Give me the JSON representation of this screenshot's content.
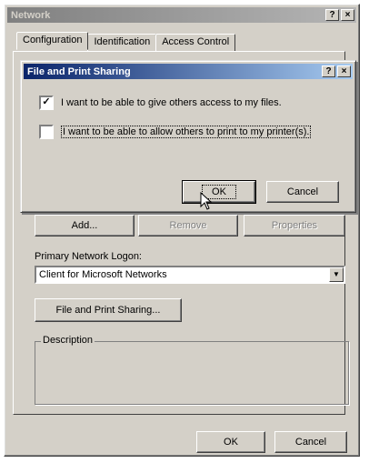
{
  "window": {
    "title": "Network",
    "help": "?",
    "close": "×"
  },
  "tabs": [
    "Configuration",
    "Identification",
    "Access Control"
  ],
  "network_buttons": {
    "add": "Add...",
    "remove": "Remove",
    "properties": "Properties"
  },
  "logon": {
    "label": "Primary Network Logon:",
    "value": "Client for Microsoft Networks"
  },
  "sharing_button": "File and Print Sharing...",
  "description_label": "Description",
  "footer": {
    "ok": "OK",
    "cancel": "Cancel"
  },
  "dialog": {
    "title": "File and Print Sharing",
    "help": "?",
    "close": "×",
    "options": [
      {
        "label": "I want to be able to give others access to my files.",
        "checked": true
      },
      {
        "label": "I want to be able to allow others to print to my printer(s).",
        "checked": false
      }
    ],
    "ok": "OK",
    "cancel": "Cancel"
  }
}
